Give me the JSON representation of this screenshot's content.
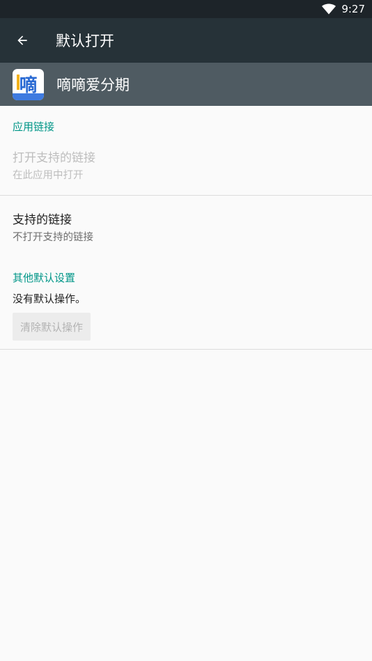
{
  "status_bar": {
    "time": "9:27",
    "wifi_icon": "wifi-icon"
  },
  "toolbar": {
    "title": "默认打开",
    "back_icon": "arrow-back-icon"
  },
  "app": {
    "name": "嘀嘀爱分期",
    "icon_glyph": "嘀"
  },
  "app_links": {
    "header": "应用链接",
    "open_supported": {
      "title": "打开支持的链接",
      "summary": "在此应用中打开"
    },
    "supported_links": {
      "title": "支持的链接",
      "summary": "不打开支持的链接"
    }
  },
  "other_defaults": {
    "header": "其他默认设置",
    "message": "没有默认操作。",
    "clear_button": "清除默认操作"
  },
  "colors": {
    "status_bar": "#1d2429",
    "toolbar": "#263238",
    "app_header": "#4f5b62",
    "accent": "#009688",
    "background": "#fafafa"
  }
}
